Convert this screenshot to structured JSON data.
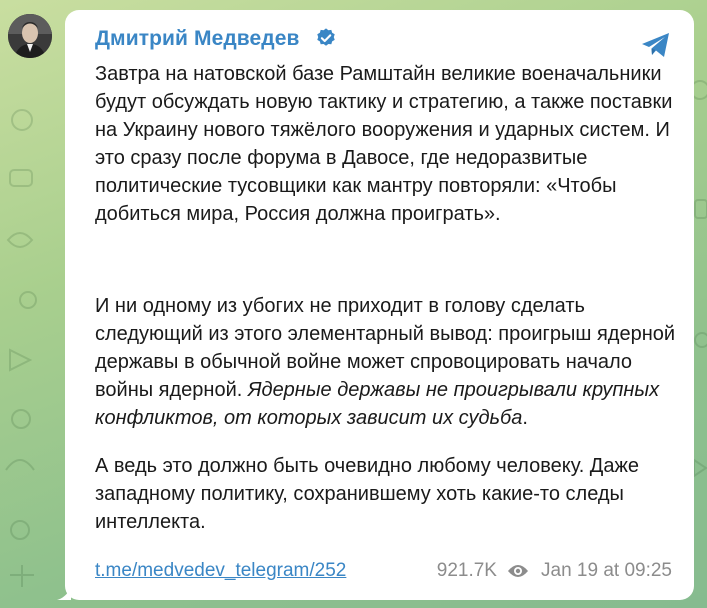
{
  "channel": {
    "name": "Дмитрий Медведев",
    "accent_color": "#3a86c5",
    "avatar_icon": "avatar-photo",
    "verified_icon": "verified-badge-icon",
    "share_icon": "telegram-logo-icon"
  },
  "message": {
    "paragraph1": "Завтра на натовской базе Рамштайн великие военачальники будут обсуждать новую тактику и стратегию, а также поставки на Украину нового тяжёлого вооружения и ударных систем. И это сразу после форума в Давосе, где недоразвитые политические тусовщики как мантру повторяли: «Чтобы добиться мира, Россия должна проиграть».",
    "paragraph2_normal": "И ни одному из убогих не приходит в голову сделать следующий из этого элементарный вывод: проигрыш ядерной державы в обычной войне может спровоцировать начало войны ядерной. ",
    "paragraph2_italic": "Ядерные державы не проигрывали крупных конфликтов, от которых зависит их судьба",
    "paragraph2_end": ".",
    "paragraph3": "А ведь это должно быть очевидно любому человеку. Даже западному политику, сохранившему хоть какие-то следы интеллекта."
  },
  "footer": {
    "link": "t.me/medvedev_telegram/252",
    "views": "921.7K",
    "views_icon": "eye-icon",
    "timestamp": "Jan 19 at 09:25"
  }
}
